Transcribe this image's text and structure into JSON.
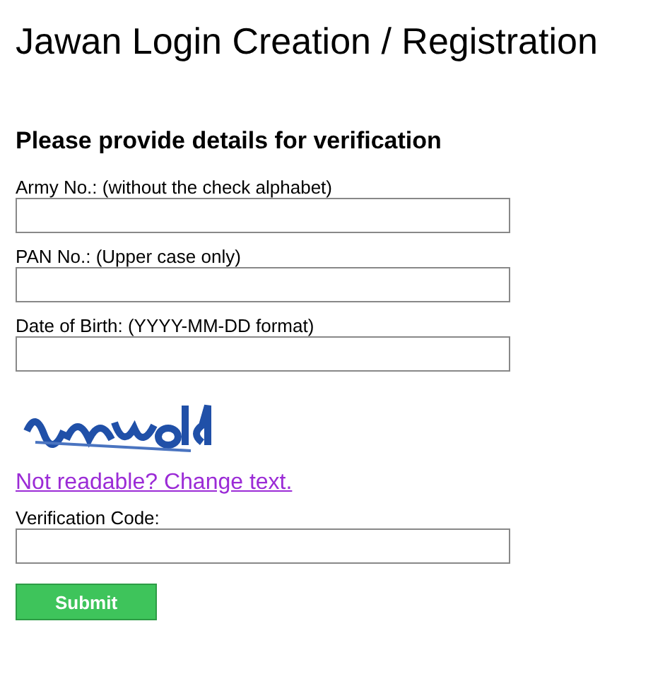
{
  "title": "Jawan Login Creation / Registration",
  "heading": "Please provide details for verification",
  "fields": [
    {
      "label": "Army No.: (without the check alphabet)"
    },
    {
      "label": "PAN No.: (Upper case only)"
    },
    {
      "label": "Date of Birth: (YYYY-MM-DD format)"
    }
  ],
  "change_link": "Not readable? Change text.",
  "verification": {
    "label": "Verification Code:"
  },
  "submit": "Submit"
}
